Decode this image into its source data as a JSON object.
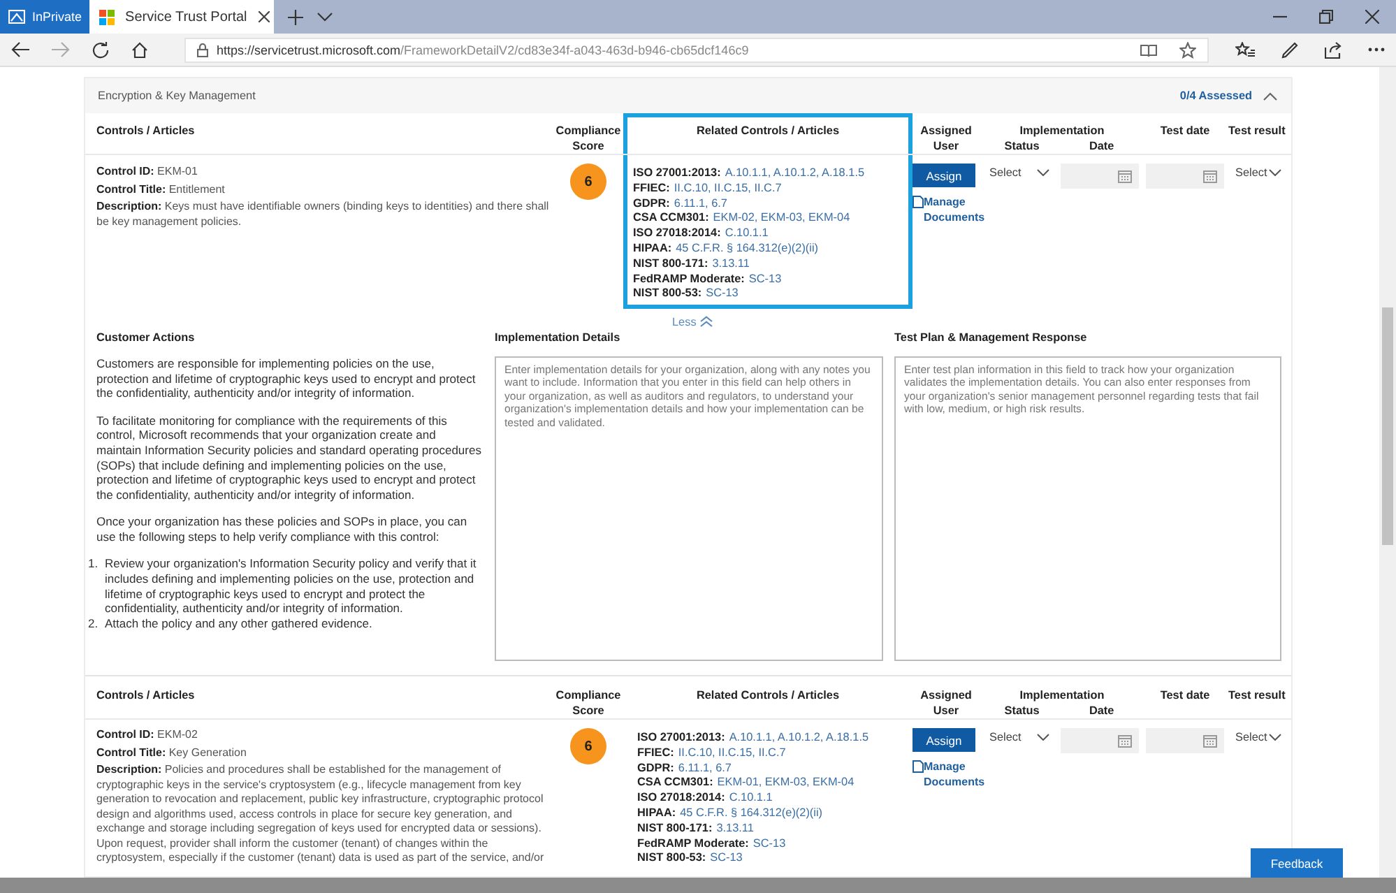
{
  "browser": {
    "private_label": "InPrivate",
    "tab": {
      "title": "Service Trust Portal",
      "selected": true
    },
    "forward_disabled": true,
    "address": {
      "host": "https://servicetrust.microsoft.com",
      "path": "/FrameworkDetailV2/cd83e34f-a043-463d-b946-cb65dcf146c9"
    }
  },
  "section": {
    "title": "Encryption & Key Management",
    "assessed": "0/4 Assessed",
    "expanded": true
  },
  "controls": [
    {
      "columns": [
        "Controls / Articles",
        "Compliance Score",
        "Related Controls / Articles",
        "Assigned User",
        {
          "label": "Implementation",
          "sublabels": [
            "Status",
            "Date"
          ]
        },
        "Test date",
        "Test result"
      ],
      "highlighted": true,
      "id": "**Control ID:** EKM-01",
      "title": "**Control Title:** Entitlement",
      "description": "**Description:** Keys must have identifiable owners (binding keys to identities) and there shall be key management policies.",
      "score": "6",
      "related": [
        {
          "framework": "ISO 27001:2013:",
          "refs": "A.10.1.1, A.10.1.2, A.18.1.5"
        },
        {
          "framework": "FFIEC:",
          "refs": "II.C.10, II.C.15, II.C.7"
        },
        {
          "framework": "GDPR:",
          "refs": "6.11.1, 6.7"
        },
        {
          "framework": "CSA CCM301:",
          "refs": "EKM-02, EKM-03, EKM-04"
        },
        {
          "framework": "ISO 27018:2014:",
          "refs": "C.10.1.1"
        },
        {
          "framework": "HIPAA:",
          "refs": "45 C.F.R. § 164.312(e)(2)(ii)"
        },
        {
          "framework": "NIST 800-171:",
          "refs": "3.13.11"
        },
        {
          "framework": "FedRAMP Moderate:",
          "refs": "SC-13"
        },
        {
          "framework": "NIST 800-53:",
          "refs": "SC-13"
        }
      ],
      "assign": "Assign",
      "manage": "Manage Documents",
      "status": "Select",
      "test_result": "Select",
      "toggle": "Less",
      "details": {
        "customer_actions": {
          "heading": "Customer Actions",
          "paragraphs": [
            "Customers are responsible for implementing policies on the use, protection and lifetime of cryptographic keys used to encrypt and protect the confidentiality, authenticity and/or integrity of information.",
            "To facilitate monitoring for compliance with the requirements of this control, Microsoft recommends that your organization create and maintain Information Security policies and standard operating procedures (SOPs) that include defining and implementing policies on the use, protection and lifetime of cryptographic keys used to encrypt and protect the confidentiality, authenticity and/or integrity of information.",
            "Once your organization has these policies and SOPs in place, you can use the following steps to help verify compliance with this control:"
          ],
          "steps": [
            {
              "number": "1.",
              "text": "Review your organization's Information Security policy and verify that it includes defining and implementing policies on the use, protection and lifetime of cryptographic keys used to encrypt and protect the confidentiality, authenticity and/or integrity of information."
            },
            {
              "number": "2.",
              "text": "Attach the policy and any other gathered evidence."
            }
          ]
        },
        "implementation": {
          "heading": "Implementation Details",
          "placeholder": "Enter implementation details for your organization, along with any notes you want to include. Information that you enter in this field can help others in your organization, as well as auditors and regulators, to understand your organization's implementation details and how your implementation can be tested and validated."
        },
        "test_plan": {
          "heading": "Test Plan & Management Response",
          "placeholder": "Enter test plan information in this field to track how your organization validates the implementation details. You can also enter responses from your organization's senior management personnel regarding tests that fail with low, medium, or high risk results."
        }
      }
    },
    {
      "columns": [
        "Controls / Articles",
        "Compliance Score",
        "Related Controls / Articles",
        "Assigned User",
        {
          "label": "Implementation",
          "sublabels": [
            "Status",
            "Date"
          ]
        },
        "Test date",
        "Test result"
      ],
      "highlighted": false,
      "id": "**Control ID:** EKM-02",
      "title": "**Control Title:** Key Generation",
      "description": "**Description:** Policies and procedures shall be established for the management of cryptographic keys in the service's cryptosystem (e.g., lifecycle management from key generation to revocation and replacement, public key infrastructure, cryptographic protocol design and algorithms used, access controls in place for secure key generation, and exchange and storage including segregation of keys used for encrypted data or sessions). Upon request, provider shall inform the customer (tenant) of changes within the cryptosystem, especially if the customer (tenant) data is used as part of the service, and/or",
      "score": "6",
      "related": [
        {
          "framework": "ISO 27001:2013:",
          "refs": "A.10.1.1, A.10.1.2, A.18.1.5"
        },
        {
          "framework": "FFIEC:",
          "refs": "II.C.10, II.C.15, II.C.7"
        },
        {
          "framework": "GDPR:",
          "refs": "6.11.1, 6.7"
        },
        {
          "framework": "CSA CCM301:",
          "refs": "EKM-01, EKM-03, EKM-04"
        },
        {
          "framework": "ISO 27018:2014:",
          "refs": "C.10.1.1"
        },
        {
          "framework": "HIPAA:",
          "refs": "45 C.F.R. § 164.312(e)(2)(ii)"
        },
        {
          "framework": "NIST 800-171:",
          "refs": "3.13.11"
        },
        {
          "framework": "FedRAMP Moderate:",
          "refs": "SC-13"
        },
        {
          "framework": "NIST 800-53:",
          "refs": "SC-13"
        }
      ],
      "assign": "Assign",
      "manage": "Manage Documents",
      "status": "Select",
      "test_result": "Select"
    }
  ],
  "feedback": "Feedback"
}
